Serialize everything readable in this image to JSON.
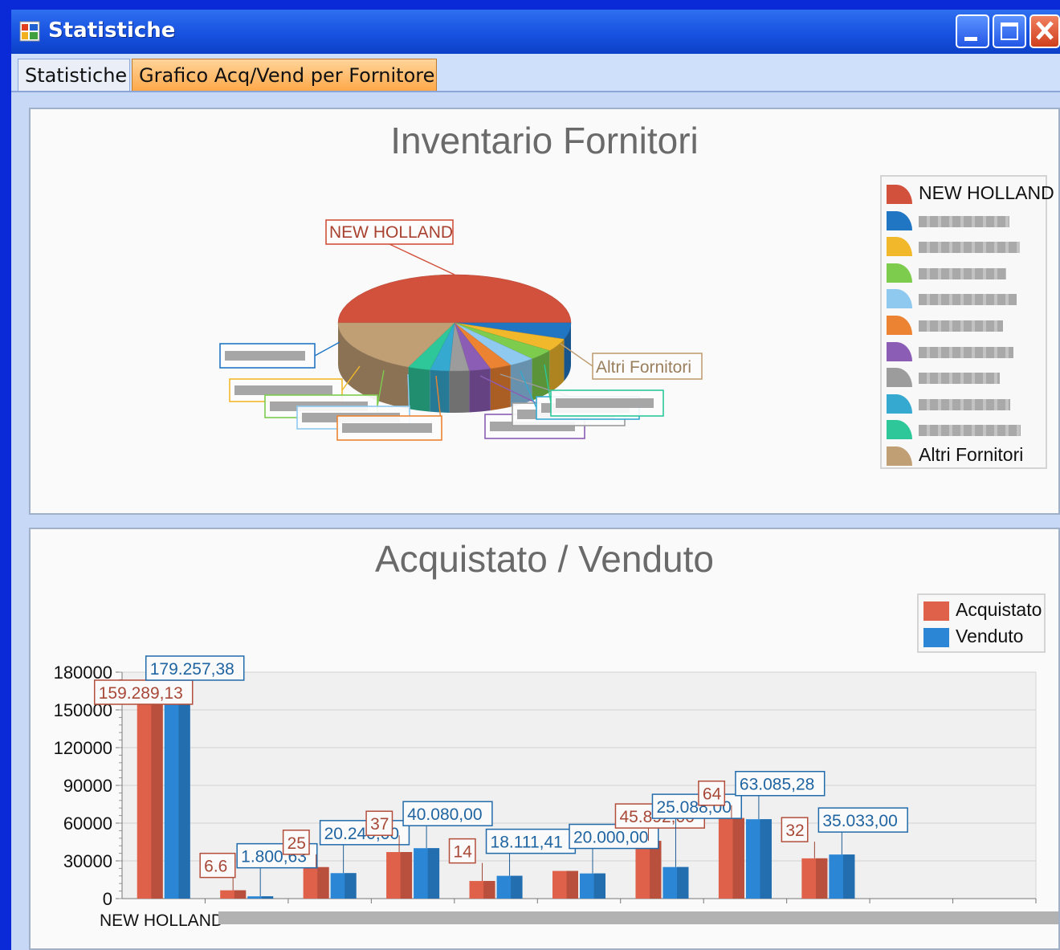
{
  "window": {
    "title": "Statistiche",
    "tabs": [
      {
        "label": "Statistiche",
        "active": false
      },
      {
        "label": "Grafico Acq/Vend per Fornitore",
        "active": true
      }
    ]
  },
  "pie_legend": [
    {
      "label": "NEW HOLLAND",
      "color": "#d2513c",
      "readable": true
    },
    {
      "label": "",
      "color": "#2176c4",
      "readable": false
    },
    {
      "label": "",
      "color": "#f2b82c",
      "readable": false
    },
    {
      "label": "",
      "color": "#7dcc4e",
      "readable": false
    },
    {
      "label": "",
      "color": "#8fc9f0",
      "readable": false
    },
    {
      "label": "",
      "color": "#ec8332",
      "readable": false
    },
    {
      "label": "",
      "color": "#8c5db5",
      "readable": false
    },
    {
      "label": "",
      "color": "#9c9c9c",
      "readable": false
    },
    {
      "label": "",
      "color": "#36a9d1",
      "readable": false
    },
    {
      "label": "",
      "color": "#2ec79a",
      "readable": false
    },
    {
      "label": "Altri Fornitori",
      "color": "#c19f74",
      "readable": true
    }
  ],
  "bar_legend": [
    {
      "label": "Acquistato",
      "color": "#e0614a"
    },
    {
      "label": "Venduto",
      "color": "#2b86d6"
    }
  ],
  "chart_data": [
    {
      "type": "pie",
      "title": "Inventario Fornitori",
      "slices": [
        {
          "label": "NEW HOLLAND",
          "value": 50.0,
          "color": "#d2513c"
        },
        {
          "label": "",
          "value": 5.5,
          "color": "#2176c4"
        },
        {
          "label": "",
          "value": 4.3,
          "color": "#f2b82c"
        },
        {
          "label": "",
          "value": 3.6,
          "color": "#7dcc4e"
        },
        {
          "label": "",
          "value": 3.6,
          "color": "#8fc9f0"
        },
        {
          "label": "",
          "value": 3.0,
          "color": "#ec8332"
        },
        {
          "label": "",
          "value": 3.0,
          "color": "#8c5db5"
        },
        {
          "label": "",
          "value": 2.7,
          "color": "#9c9c9c"
        },
        {
          "label": "",
          "value": 2.7,
          "color": "#36a9d1"
        },
        {
          "label": "",
          "value": 3.1,
          "color": "#2ec79a"
        },
        {
          "label": "Altri Fornitori",
          "value": 18.5,
          "color": "#c19f74"
        }
      ],
      "callout_labels": [
        "NEW HOLLAND",
        "Altri Fornitori"
      ],
      "legend": "right"
    },
    {
      "type": "bar",
      "title": "Acquistato / Venduto",
      "categories": [
        "NEW HOLLAND",
        "",
        "",
        "",
        "",
        "",
        "",
        "",
        "",
        "",
        ""
      ],
      "series": [
        {
          "name": "Acquistato",
          "values": [
            159289.13,
            6600,
            25000,
            37000,
            14000,
            22000,
            45892.0,
            64000,
            32000,
            null,
            null
          ],
          "labels": [
            "159.289,13",
            "6.6",
            "25",
            "37",
            "14",
            "",
            "45.892,00",
            "64",
            "32",
            "",
            ""
          ]
        },
        {
          "name": "Venduto",
          "values": [
            179257.38,
            1800.63,
            20240.0,
            40080.0,
            18111.41,
            20000.0,
            25088.0,
            63085.28,
            35033.0,
            null,
            null
          ],
          "labels": [
            "179.257,38",
            "1.800,63",
            "20.240,00",
            "40.080,00",
            "18.111,41",
            "20.000,00",
            "25.088,00",
            "63.085,28",
            "35.033,00",
            "",
            ""
          ]
        }
      ],
      "yticks": [
        "0",
        "30000",
        "60000",
        "90000",
        "120000",
        "150000",
        "180000"
      ],
      "ylim": [
        0,
        180000
      ],
      "grid": true,
      "legend": "top-right"
    }
  ]
}
